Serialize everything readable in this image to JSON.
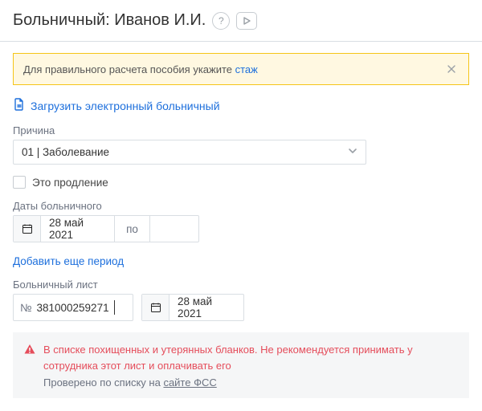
{
  "header": {
    "title": "Больничный: Иванов И.И."
  },
  "banner": {
    "text_before": "Для правильного расчета пособия укажите ",
    "link_text": "стаж"
  },
  "upload": {
    "link": "Загрузить электронный больничный"
  },
  "reason": {
    "label": "Причина",
    "value": "01 | Заболевание"
  },
  "extension": {
    "label": "Это продление"
  },
  "dates": {
    "label": "Даты больничного",
    "start": "28 май 2021",
    "separator": "по",
    "end": ""
  },
  "add_period": "Добавить еще период",
  "sheet": {
    "label": "Больничный лист",
    "number_prefix": "№",
    "number_value": "381000259271",
    "date": "28 май 2021"
  },
  "alert": {
    "text": "В списке похищенных и утерянных бланков. Не рекомендуется принимать у сотрудника этот лист и оплачивать его",
    "sub_before": "Проверено по списку на ",
    "sub_link": "сайте ФСС"
  }
}
